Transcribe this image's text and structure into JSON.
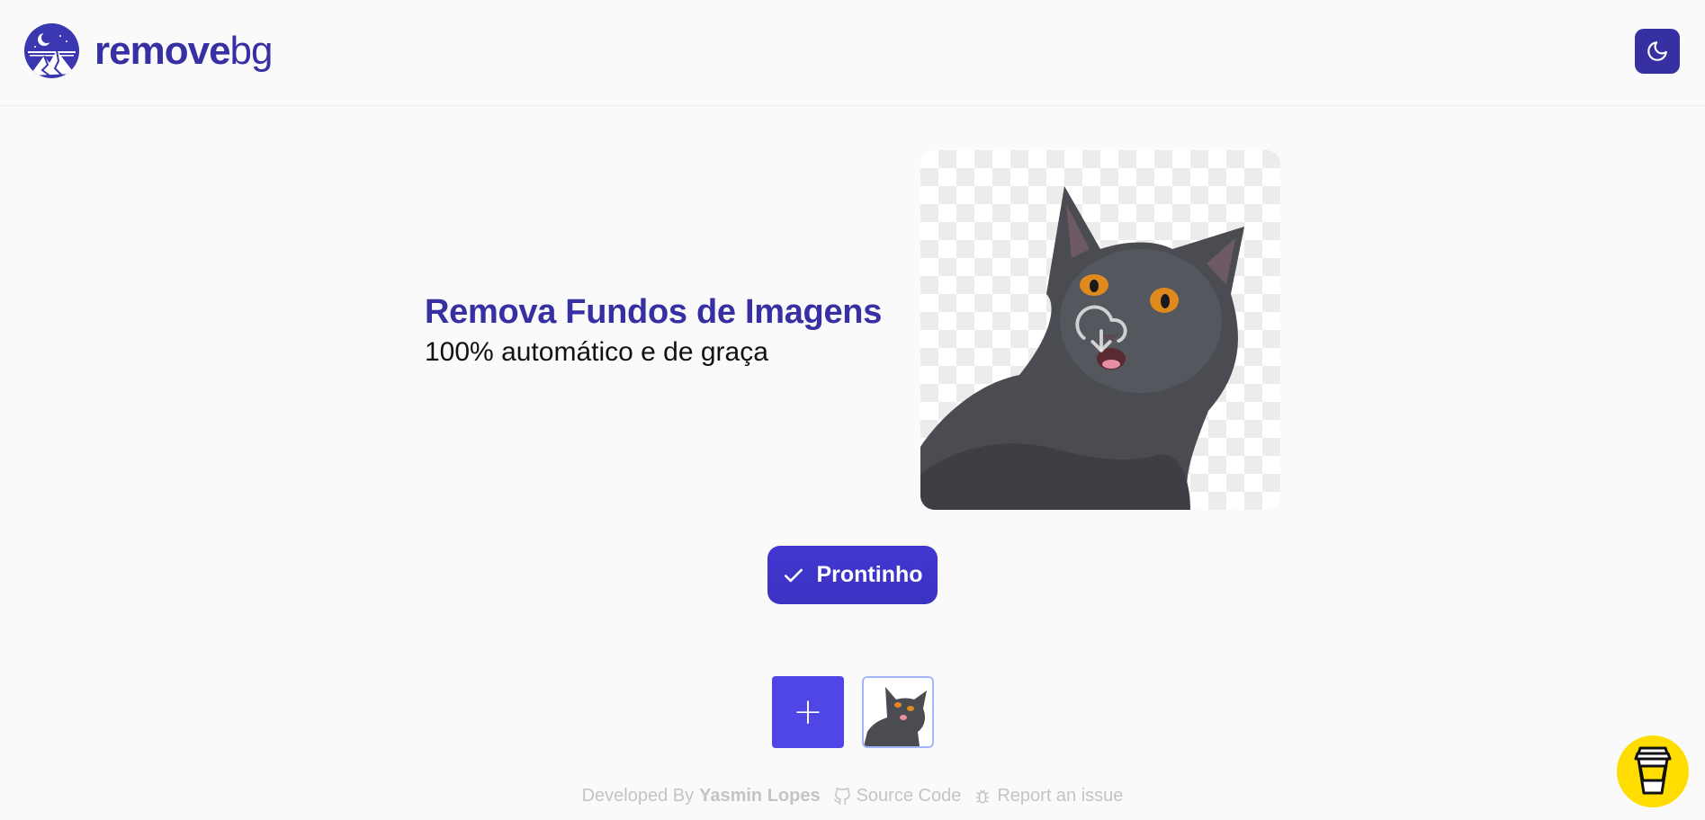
{
  "header": {
    "logo_bold": "remove",
    "logo_light": "bg",
    "theme_icon": "moon-icon"
  },
  "hero": {
    "title": "Remova Fundos de Imagens",
    "subtitle": "100% automático e de graça",
    "download_icon": "cloud-download-icon"
  },
  "actions": {
    "done_label": "Prontinho",
    "done_icon": "check-icon",
    "add_label": "+"
  },
  "footer": {
    "developed_by": "Developed By",
    "author": "Yasmin Lopes",
    "source_code": "Source Code",
    "report_issue": "Report an issue"
  },
  "colors": {
    "brand": "#3730a3",
    "accent": "#4f46e5",
    "coffee": "#ffdd00"
  }
}
